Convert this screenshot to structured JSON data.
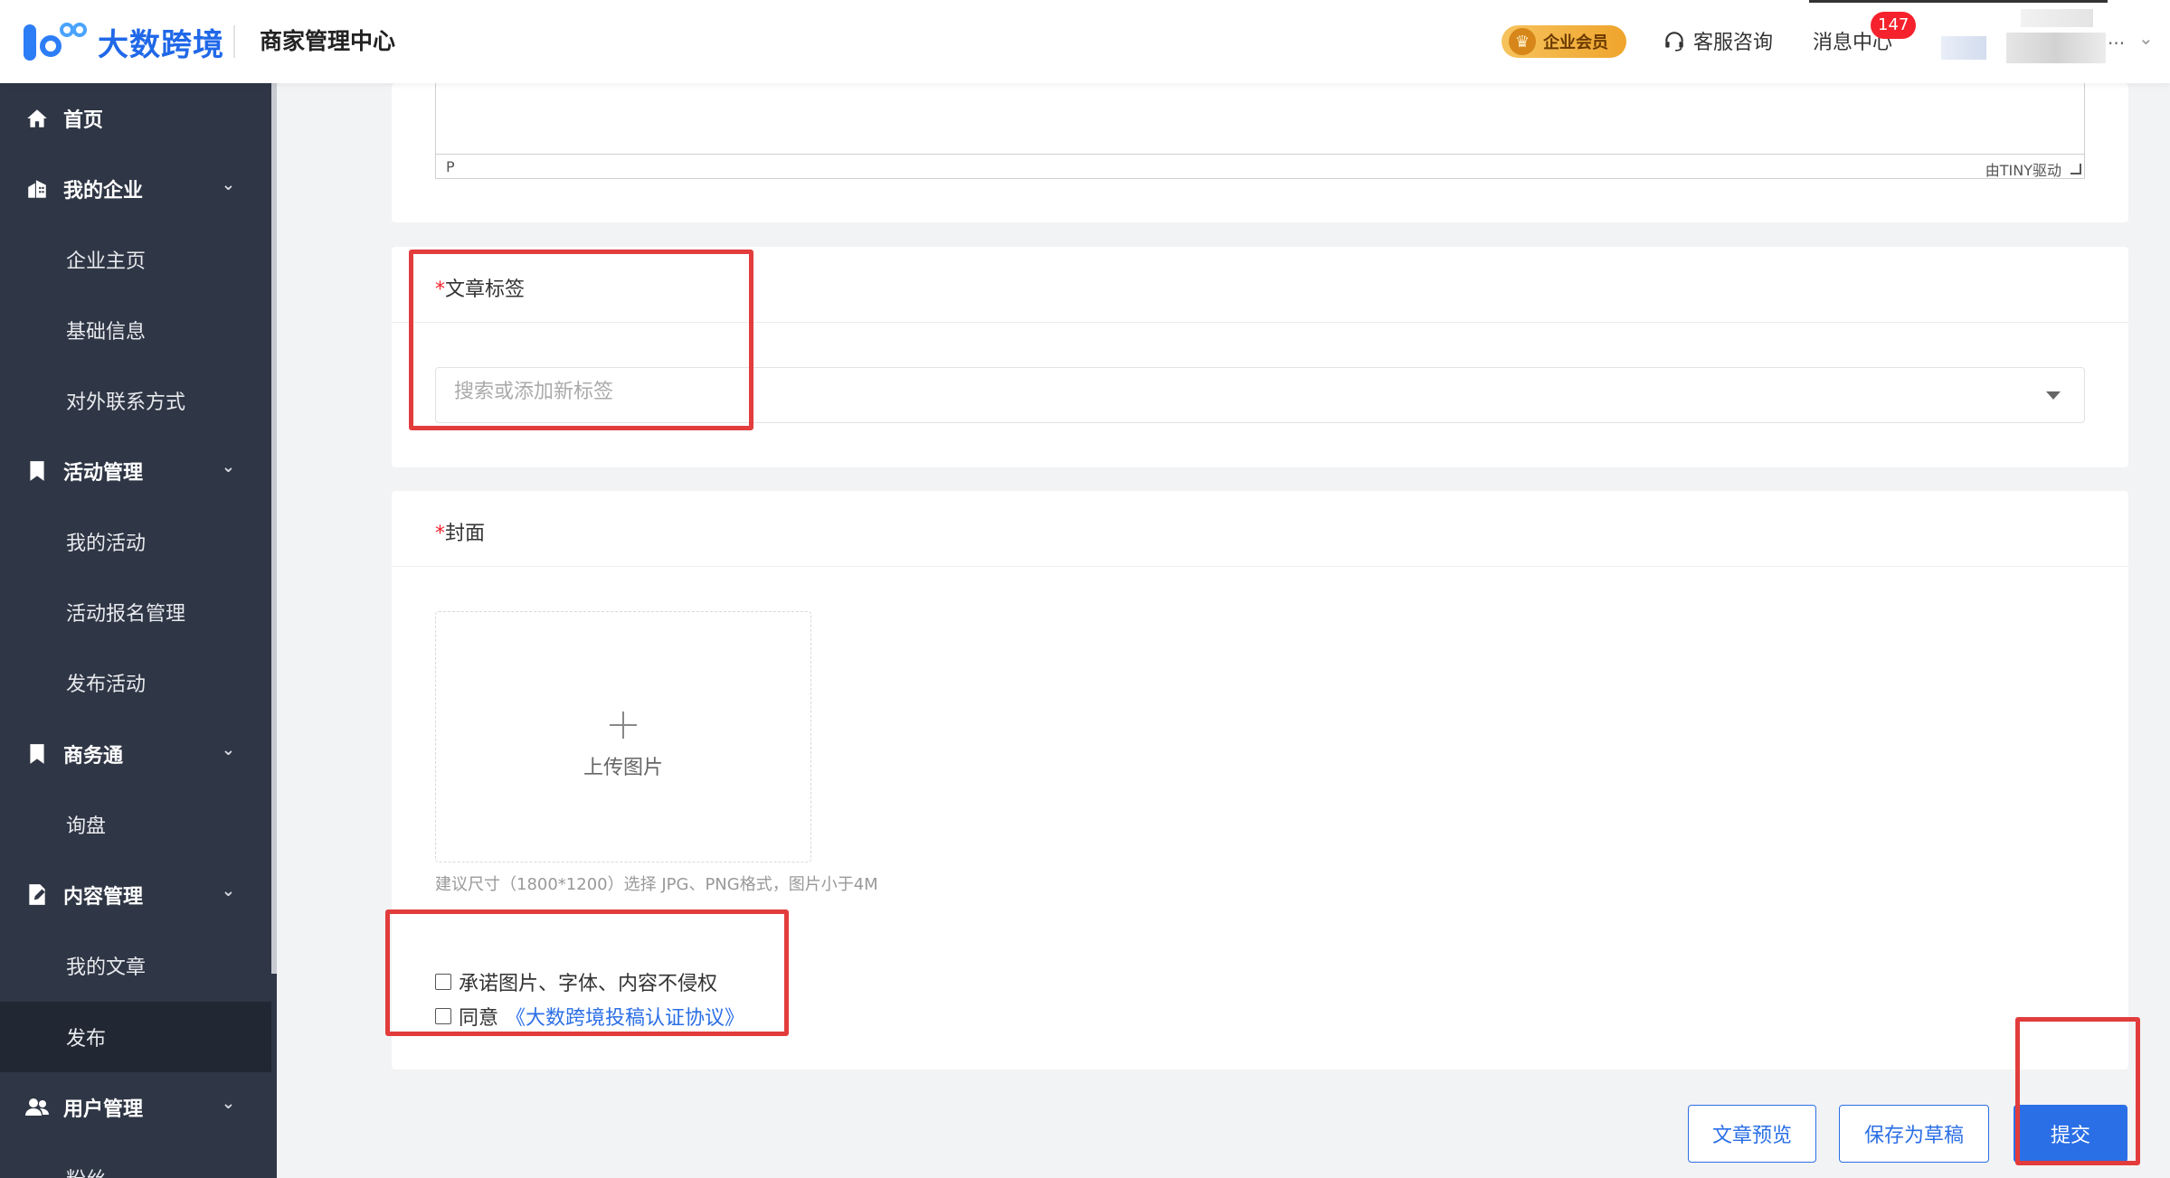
{
  "header": {
    "logo_text": "大数跨境",
    "system_title": "商家管理中心",
    "vip_label": "企业会员",
    "service_label": "客服咨询",
    "message_label": "消息中心",
    "message_badge": "147",
    "ellipsis": "..."
  },
  "sidebar": {
    "items": [
      {
        "label": "首页"
      },
      {
        "label": "我的企业"
      },
      {
        "label": "企业主页"
      },
      {
        "label": "基础信息"
      },
      {
        "label": "对外联系方式"
      },
      {
        "label": "活动管理"
      },
      {
        "label": "我的活动"
      },
      {
        "label": "活动报名管理"
      },
      {
        "label": "发布活动"
      },
      {
        "label": "商务通"
      },
      {
        "label": "询盘"
      },
      {
        "label": "内容管理"
      },
      {
        "label": "我的文章"
      },
      {
        "label": "发布"
      },
      {
        "label": "用户管理"
      },
      {
        "label": "粉丝"
      }
    ]
  },
  "editor": {
    "status_path": "P",
    "powered_by": "由TINY驱动"
  },
  "tags_section": {
    "required_mark": "*",
    "title": "文章标签",
    "placeholder": "搜索或添加新标签"
  },
  "cover_section": {
    "required_mark": "*",
    "title": "封面",
    "upload_label": "上传图片",
    "hint": "建议尺寸（1800*1200）选择 JPG、PNG格式，图片小于4M"
  },
  "agreements": {
    "promise_label": "承诺图片、字体、内容不侵权",
    "agree_label": "同意",
    "agree_link": "《大数跨境投稿认证协议》"
  },
  "actions": {
    "preview": "文章预览",
    "save_draft": "保存为草稿",
    "submit": "提交"
  },
  "colors": {
    "accent": "#2b6fe6",
    "sidebar_bg": "#2f3645",
    "highlight_red": "#e23c3c"
  }
}
